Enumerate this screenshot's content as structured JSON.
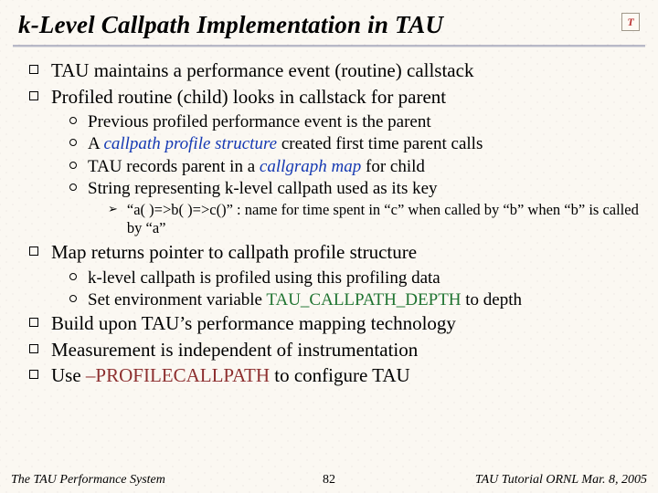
{
  "title": "k-Level Callpath Implementation in TAU",
  "logo_letter": "T",
  "b1": "TAU maintains a performance event (routine) callstack",
  "b2": "Profiled routine (child) looks in callstack for parent",
  "b2_1": "Previous profiled performance event is the parent",
  "b2_2a": "A ",
  "b2_2b": "callpath profile structure",
  "b2_2c": " created first time parent calls",
  "b2_3a": "TAU records parent in a ",
  "b2_3b": "callgraph map",
  "b2_3c": " for child",
  "b2_4": "String representing k-level callpath used as its key",
  "b2_4_1": "“a( )=>b( )=>c()” : name for time spent in “c” when called by “b” when “b” is called by “a”",
  "b3": "Map returns pointer to callpath profile structure",
  "b3_1": "k-level callpath is profiled using this profiling data",
  "b3_2a": "Set environment variable ",
  "b3_2b": "TAU_CALLPATH_DEPTH",
  "b3_2c": " to depth",
  "b4": "Build upon TAU’s performance mapping technology",
  "b5": "Measurement is independent of instrumentation",
  "b6a": "Use ",
  "b6b": "–PROFILECALLPATH",
  "b6c": " to configure TAU",
  "footer_left": "The TAU Performance System",
  "footer_center": "82",
  "footer_right": "TAU Tutorial ORNL Mar. 8, 2005"
}
